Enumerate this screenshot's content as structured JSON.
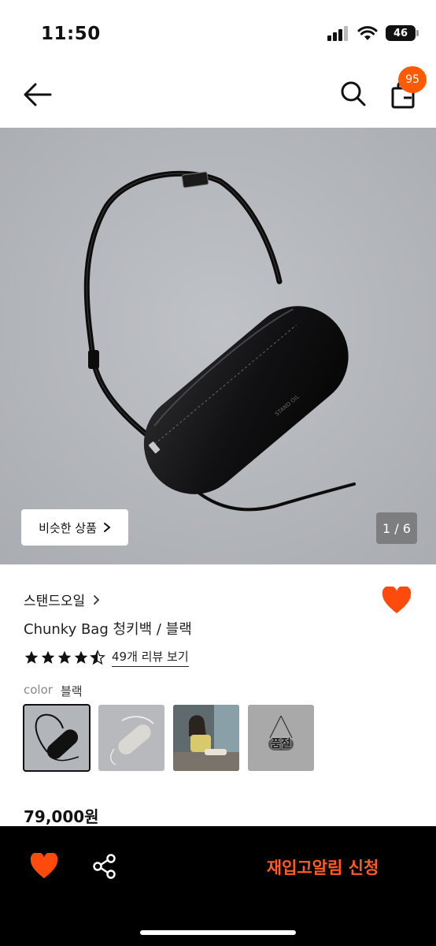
{
  "status_bar": {
    "time": "11:50",
    "battery": "46"
  },
  "header": {
    "cart_count": "95"
  },
  "gallery": {
    "similar_label": "비슷한 상품",
    "counter": "1 / 6"
  },
  "product": {
    "brand": "스탠드오일",
    "name": "Chunky Bag 청키백 / 블랙",
    "rating": 4.5,
    "review_link": "49개 리뷰 보기",
    "color_label": "color",
    "color_value": "블랙",
    "swatches": [
      {
        "name": "black"
      },
      {
        "name": "silver"
      },
      {
        "name": "model-photo"
      },
      {
        "name": "soldout",
        "label": "품절"
      }
    ],
    "price": "79,000원"
  },
  "bottom_bar": {
    "restock_label": "재입고알림 신청"
  },
  "colors": {
    "accent": "#ff5a00",
    "heart": "#ff4a0e"
  }
}
